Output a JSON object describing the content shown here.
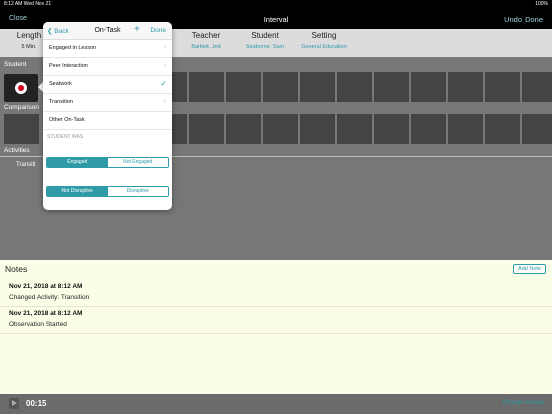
{
  "status_bar": {
    "time": "8:12 AM   Wed Nov 21",
    "right": "100%"
  },
  "navbar": {
    "close": "Close",
    "title": "Interval",
    "undo": "Undo",
    "done": "Done"
  },
  "info": {
    "length": {
      "header": "Length",
      "value": "5 Min."
    },
    "teacher": {
      "header": "Teacher",
      "value": "Bartlett, Jed"
    },
    "student": {
      "header": "Student",
      "value": "Seaborne, Sam"
    },
    "setting": {
      "header": "Setting",
      "value": "General Education"
    }
  },
  "sections": {
    "student": "Student",
    "comparison": "Comparison",
    "activities": "Activities",
    "activity_text": "Transiti"
  },
  "popover": {
    "back": "Back",
    "title": "On-Task",
    "plus": "+",
    "done": "Done",
    "options": [
      "Engaged in Lesson",
      "Peer Interaction",
      "Seatwork",
      "Transition",
      "Other On-Task"
    ],
    "selected": "Seatwork",
    "student_was": "STUDENT WAS",
    "engagement": {
      "left": "Engaged",
      "right": "Not Engaged",
      "selected": "Engaged"
    },
    "disruption": {
      "left": "Not Disruptive",
      "right": "Disruptive",
      "selected": "Not Disruptive"
    }
  },
  "notes": {
    "title": "Notes",
    "add_note": "Add Note",
    "items": [
      {
        "date": "Nov 21, 2018 at 8:12 AM",
        "text": "Changed Activity: Transition"
      },
      {
        "date": "Nov 21, 2018 at 8:12 AM",
        "text": "Observation Started"
      }
    ]
  },
  "bottom": {
    "timer": "00:15",
    "change_activity": "Change Activity"
  },
  "colors": {
    "accent": "#2f9aa8",
    "record": "#d0021b",
    "notes_bg": "#fcfde6"
  }
}
